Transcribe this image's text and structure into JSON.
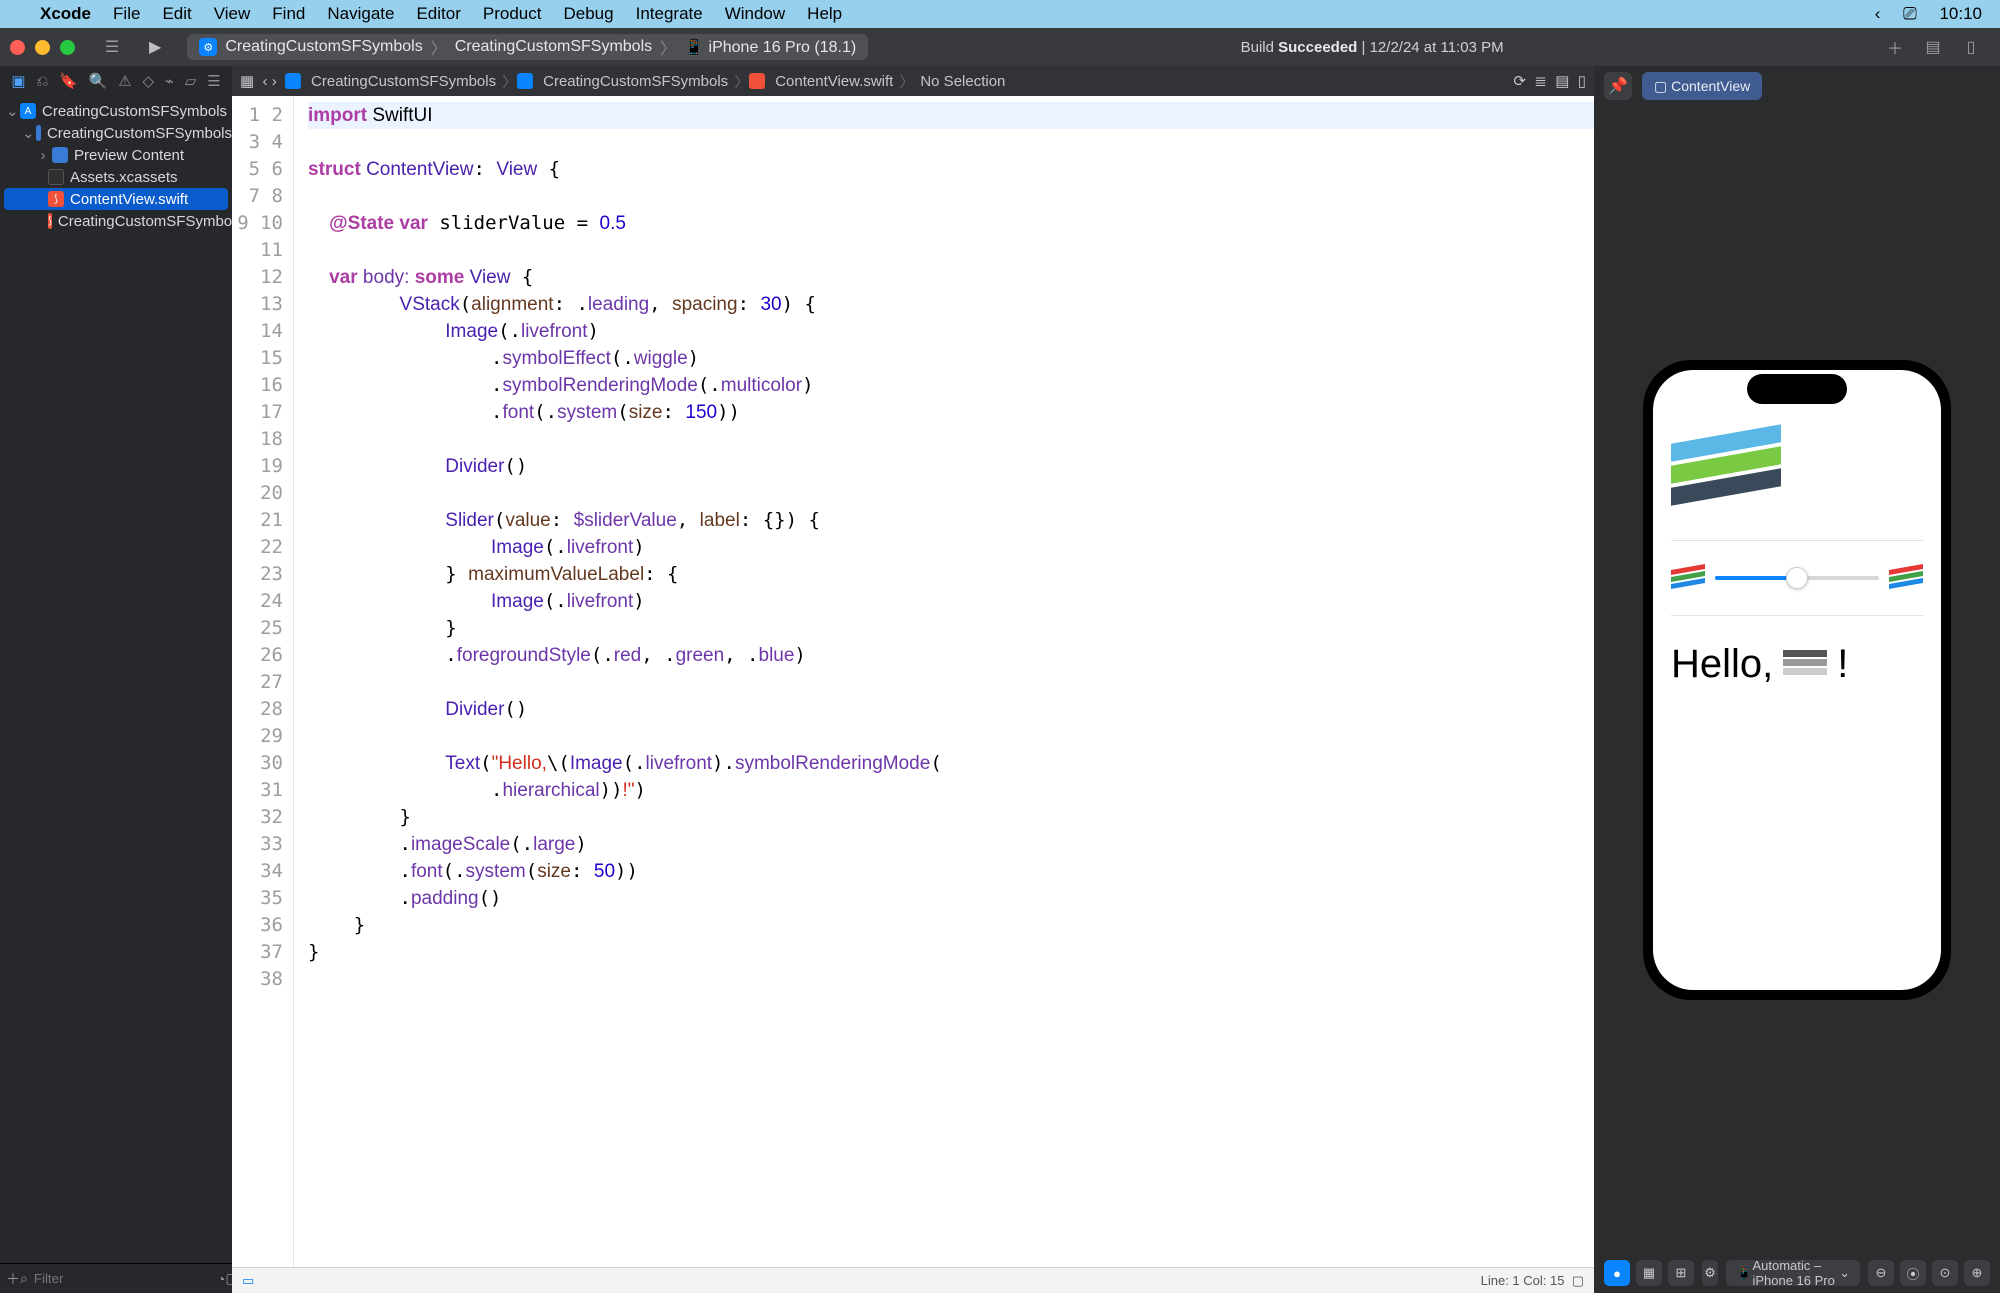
{
  "menubar": {
    "app": "Xcode",
    "items": [
      "File",
      "Edit",
      "View",
      "Find",
      "Navigate",
      "Editor",
      "Product",
      "Debug",
      "Integrate",
      "Window",
      "Help"
    ],
    "clock": "10:10"
  },
  "titlebar": {
    "project": "CreatingCustomSFSymbols",
    "scheme": "CreatingCustomSFSymbols",
    "device": "iPhone 16 Pro (18.1)",
    "status_prefix": "Build",
    "status_word": "Succeeded",
    "status_time": "12/2/24 at 11:03 PM"
  },
  "jumpbar": {
    "a": "CreatingCustomSFSymbols",
    "b": "CreatingCustomSFSymbols",
    "c": "ContentView.swift",
    "d": "No Selection"
  },
  "tree": {
    "root": "CreatingCustomSFSymbols",
    "group": "CreatingCustomSFSymbols",
    "preview": "Preview Content",
    "assets": "Assets.xcassets",
    "file_sel": "ContentView.swift",
    "file_app": "CreatingCustomSFSymbolsApp.swift"
  },
  "filter_placeholder": "Filter",
  "code": {
    "lines": 38,
    "l1a": "import",
    "l1b": " SwiftUI",
    "l3a": "struct",
    "l3b": " ContentView",
    "l3c": ": ",
    "l3d": "View",
    "l3e": " {",
    "l5a": "    @State",
    "l5b": " var",
    "l5c": " sliderValue = ",
    "l5d": "0.5",
    "l7a": "    var",
    "l7b": " body: ",
    "l7c": "some",
    "l7d": " View",
    "l7e": " {",
    "l8a": "        VStack",
    "l8b": "(alignment",
    "l8c": ": .",
    "l8d": "leading",
    "l8e": ", ",
    "l8f": "spacing",
    "l8g": ": ",
    "l8h": "30",
    "l8i": ") {",
    "l9a": "            Image",
    "l9b": "(.livefront)",
    "l10a": "                .symbolEffect",
    "l10b": "(.wiggle)",
    "l11a": "                .symbolRenderingMode",
    "l11b": "(.multicolor)",
    "l12a": "                .font",
    "l12b": "(.system(",
    "l12c": "size",
    "l12d": ": ",
    "l12e": "150",
    "l12f": "))",
    "l14": "            Divider()",
    "l16a": "            Slider",
    "l16b": "(",
    "l16c": "value",
    "l16d": ": ",
    "l16e": "$sliderValue",
    "l16f": ", ",
    "l16g": "label",
    "l16h": ": {}) {",
    "l17a": "                Image",
    "l17b": "(.livefront)",
    "l18a": "            } ",
    "l18b": "maximumValueLabel",
    "l18c": ": {",
    "l19a": "                Image",
    "l19b": "(.livefront)",
    "l20": "            }",
    "l21a": "            .foregroundStyle",
    "l21b": "(.red, .green, .blue)",
    "l23": "            Divider()",
    "l25a": "            Text",
    "l25b": "(",
    "l25c": "\"Hello,",
    "l25d": "\\(",
    "l25e": "Image",
    "l25f": "(.livefront).",
    "l25g": "symbolRenderingMode",
    "l25h": "(",
    "l25ia": "                .hierarchical",
    "l25ib": "))",
    "l25ic": "!\"",
    "l25id": ")",
    "l26": "        }",
    "l27a": "        .imageScale",
    "l27b": "(.large)",
    "l28a": "        .font",
    "l28b": "(.system(",
    "l28c": "size",
    "l28d": ": ",
    "l28e": "50",
    "l28f": "))",
    "l29": "        .padding()",
    "l30": "    }",
    "l31": "}"
  },
  "statusbar": {
    "pos": "Line: 1  Col: 15"
  },
  "canvas": {
    "pill": "ContentView",
    "hello": "Hello,",
    "bang": "!",
    "device_label": "Automatic – iPhone 16 Pro"
  }
}
